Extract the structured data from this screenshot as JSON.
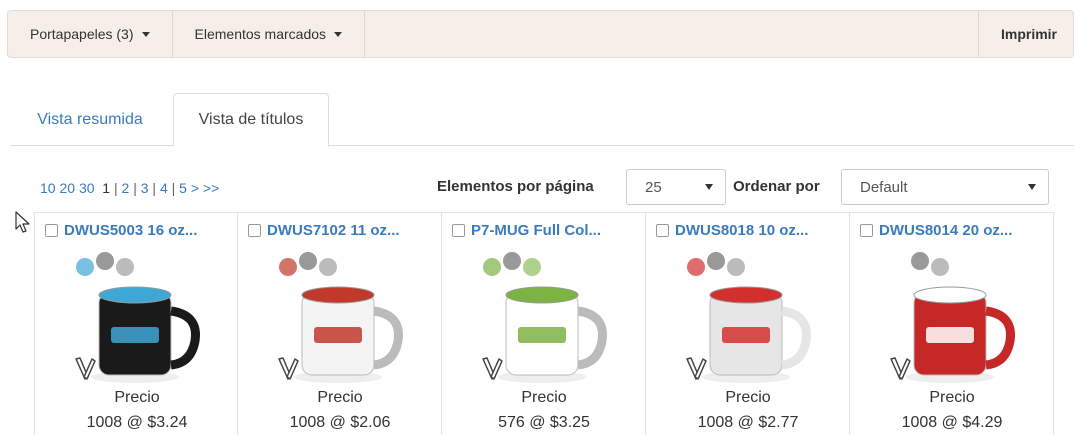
{
  "toolbar": {
    "clipboard_label": "Portapapeles (3)",
    "marked_label": "Elementos marcados",
    "print_label": "Imprimir"
  },
  "tabs": [
    {
      "label": "Vista resumida",
      "active": false
    },
    {
      "label": "Vista de títulos",
      "active": true
    }
  ],
  "pager": {
    "sizes": [
      "10",
      "20",
      "30"
    ],
    "current": "1",
    "pages": [
      "2",
      "3",
      "4",
      "5"
    ],
    "next": ">",
    "last": ">>"
  },
  "controls": {
    "per_page_label": "Elementos por página",
    "per_page_value": "25",
    "sort_label": "Ordenar por",
    "sort_value": "Default"
  },
  "products": [
    {
      "title": "DWUS5003  16 oz...",
      "price_label": "Precio",
      "price": "1008 @ $3.24",
      "mug_color": "#1a1a1a",
      "accent": "#3fa7d6"
    },
    {
      "title": "DWUS7102  11 oz...",
      "price_label": "Precio",
      "price": "1008 @ $2.06",
      "mug_color": "#f4f4f4",
      "accent": "#c0392b"
    },
    {
      "title": "P7-MUG  Full Col...",
      "price_label": "Precio",
      "price": "576 @ $3.25",
      "mug_color": "#ffffff",
      "accent": "#7cb342"
    },
    {
      "title": "DWUS8018  10 oz...",
      "price_label": "Precio",
      "price": "1008 @ $2.77",
      "mug_color": "#e6e6e6",
      "accent": "#d32f2f"
    },
    {
      "title": "DWUS8014  20 oz...",
      "price_label": "Precio",
      "price": "1008 @ $4.29",
      "mug_color": "#c62828",
      "accent": "#ffffff"
    }
  ]
}
